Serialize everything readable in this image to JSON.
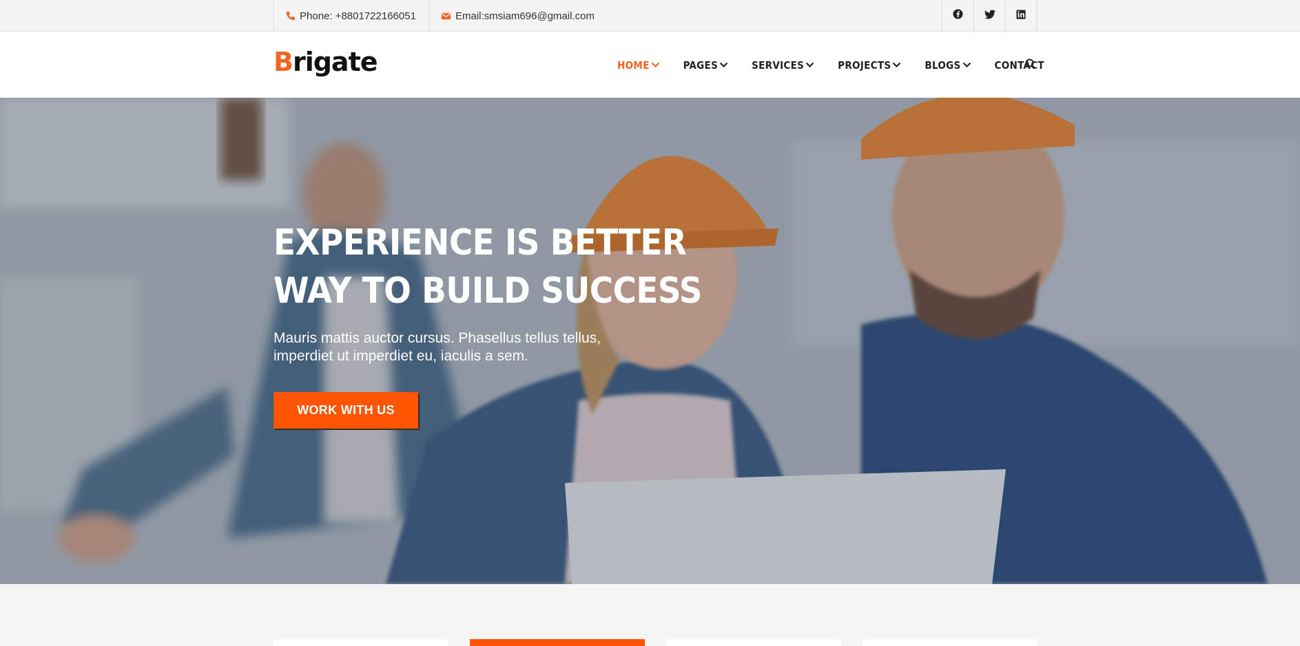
{
  "topbar": {
    "phone": "Phone: +8801722166051",
    "email": "Email:smsiam696@gmail.com",
    "socials": [
      "facebook-icon",
      "twitter-icon",
      "linkedin-icon"
    ]
  },
  "header": {
    "logo_first": "B",
    "logo_rest": "rigate",
    "nav": [
      {
        "label": "HOME",
        "dropdown": true,
        "active": true
      },
      {
        "label": "PAGES",
        "dropdown": true
      },
      {
        "label": "SERVICES",
        "dropdown": true
      },
      {
        "label": "PROJECTS",
        "dropdown": true
      },
      {
        "label": "BLOGS",
        "dropdown": true
      },
      {
        "label": "CONTACT",
        "dropdown": false
      }
    ],
    "search_icon": "search-icon"
  },
  "hero": {
    "title_line1": "EXPERIENCE IS BETTER",
    "title_line2": "WAY TO BUILD SUCCESS",
    "subtitle": "Mauris mattis auctor cursus. Phasellus tellus tellus, imperdiet ut imperdiet eu, iaculis a sem.",
    "button": "WORK WITH US"
  },
  "colors": {
    "accent": "#f26522",
    "button": "#ff5500"
  }
}
